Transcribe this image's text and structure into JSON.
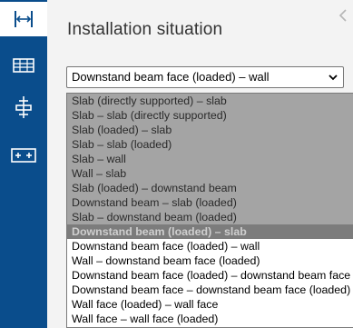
{
  "toolbar": {
    "tools": [
      {
        "icon": "beam-connection-icon",
        "active": true
      },
      {
        "icon": "slab-grid-icon",
        "active": false
      },
      {
        "icon": "anchor-support-icon",
        "active": false
      },
      {
        "icon": "double-plus-icon",
        "active": false
      }
    ]
  },
  "panel": {
    "title": "Installation situation",
    "select": {
      "value": "Downstand beam face (loaded) – wall"
    },
    "options": [
      {
        "label": "Slab (directly supported) – slab",
        "state": "disabled"
      },
      {
        "label": "Slab – slab (directly supported)",
        "state": "disabled"
      },
      {
        "label": "Slab (loaded) – slab",
        "state": "disabled"
      },
      {
        "label": "Slab – slab (loaded)",
        "state": "disabled"
      },
      {
        "label": "Slab – wall",
        "state": "disabled"
      },
      {
        "label": "Wall – slab",
        "state": "disabled"
      },
      {
        "label": "Slab (loaded) – downstand beam",
        "state": "disabled"
      },
      {
        "label": "Downstand beam – slab (loaded)",
        "state": "disabled"
      },
      {
        "label": "Slab – downstand beam (loaded)",
        "state": "disabled"
      },
      {
        "label": "Downstand beam (loaded) – slab",
        "state": "selected"
      },
      {
        "label": "Downstand beam face (loaded) – wall",
        "state": "normal"
      },
      {
        "label": "Wall – downstand beam face (loaded)",
        "state": "normal"
      },
      {
        "label": "Downstand beam face (loaded) – downstand beam face",
        "state": "normal"
      },
      {
        "label": "Downstand beam face – downstand beam face (loaded)",
        "state": "normal"
      },
      {
        "label": "Wall face (loaded) – wall face",
        "state": "normal"
      },
      {
        "label": "Wall face – wall face (loaded)",
        "state": "normal"
      }
    ]
  },
  "colors": {
    "sidebar": "#0a4d8c",
    "panel": "#f3f3f3",
    "disabled_option": "#a4a4a4",
    "selected_option": "#7c7c7c"
  }
}
